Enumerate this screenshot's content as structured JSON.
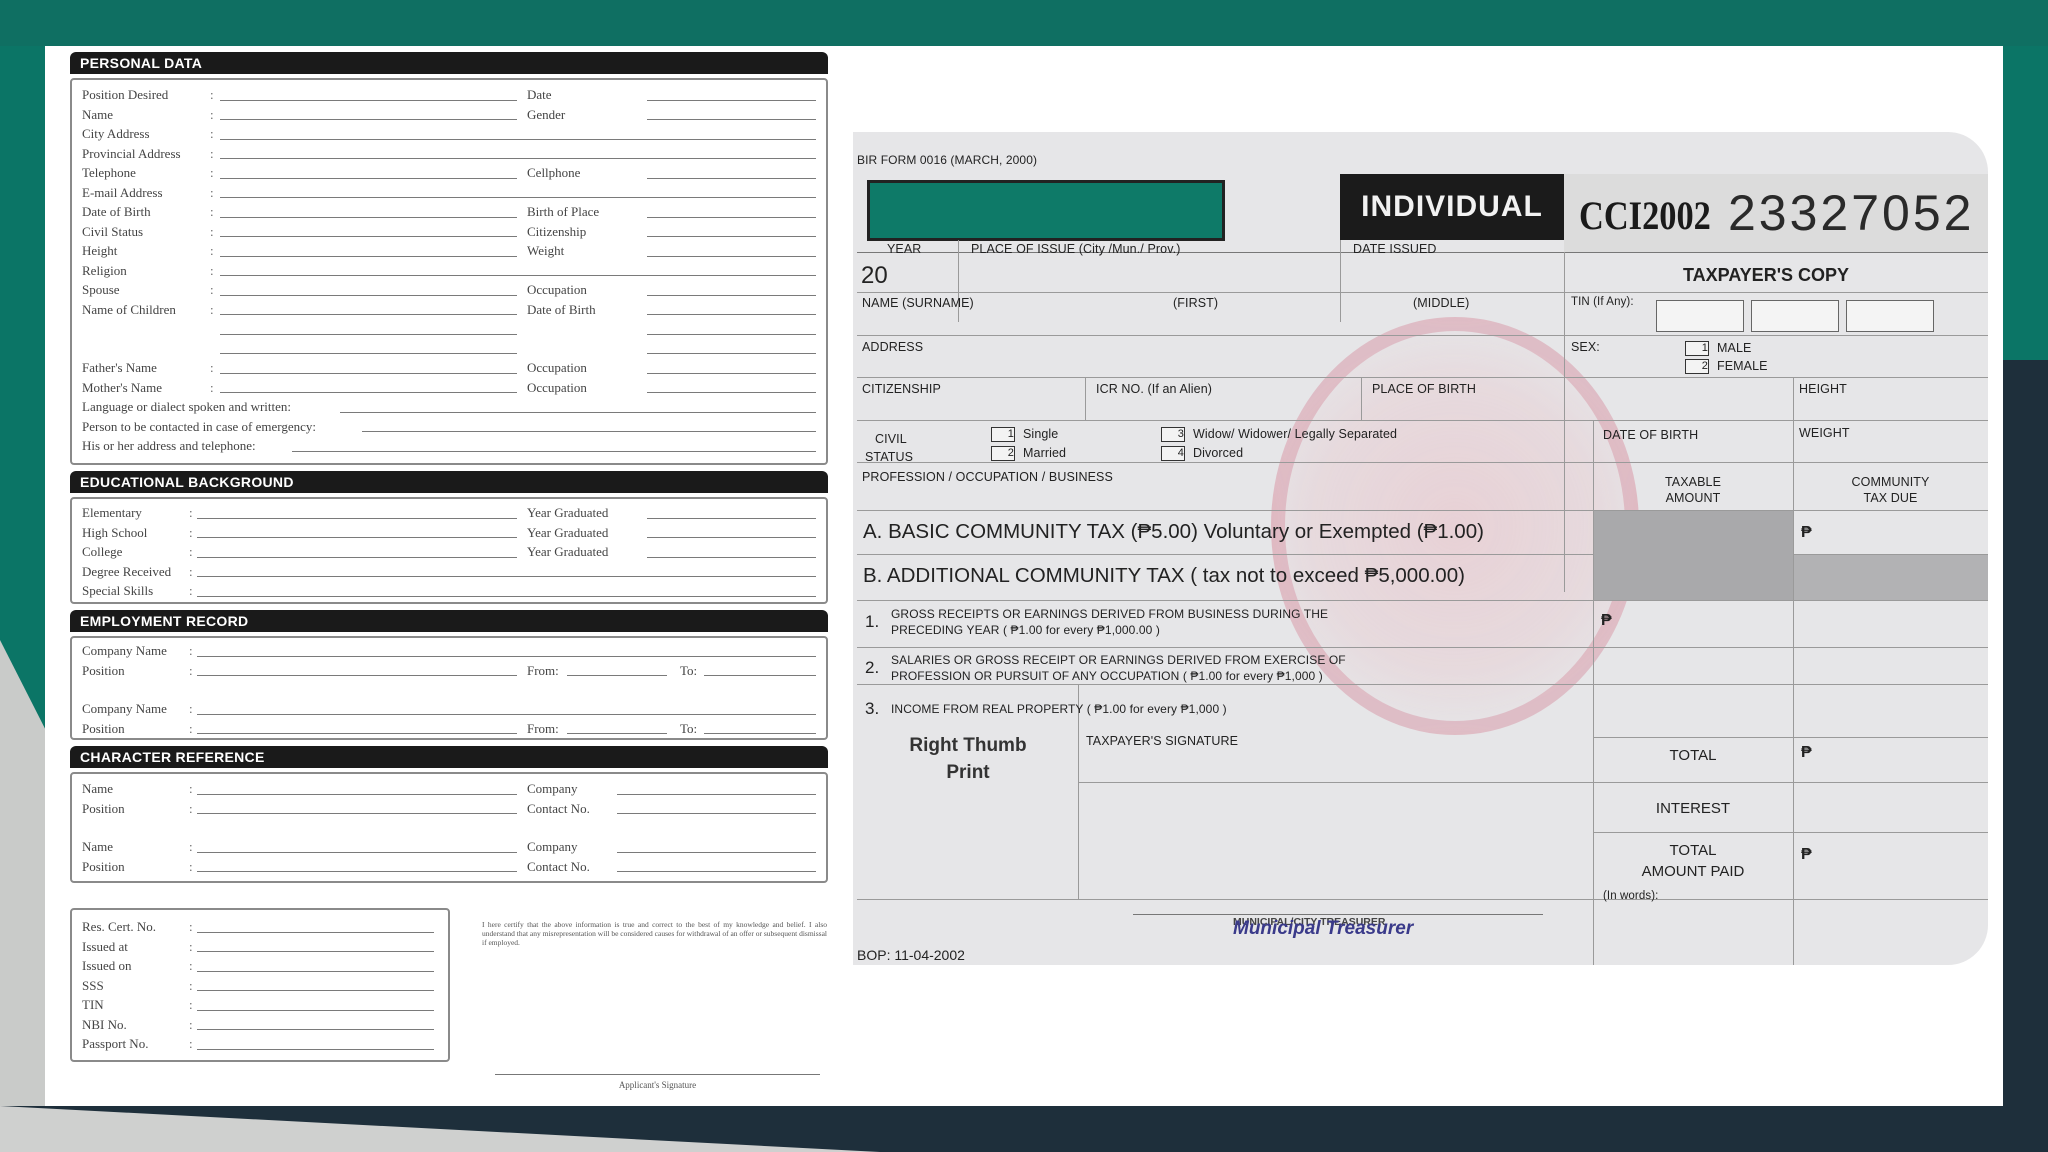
{
  "left_form": {
    "personal_data": {
      "header": "PERSONAL DATA",
      "rows": [
        {
          "left": "Position Desired",
          "right": "Date"
        },
        {
          "left": "Name",
          "right": "Gender"
        },
        {
          "left": "City Address",
          "right": ""
        },
        {
          "left": "Provincial Address",
          "right": ""
        },
        {
          "left": "Telephone",
          "right": "Cellphone"
        },
        {
          "left": "E-mail Address",
          "right": ""
        },
        {
          "left": "Date of Birth",
          "right": "Birth of Place"
        },
        {
          "left": "Civil Status",
          "right": "Citizenship"
        },
        {
          "left": "Height",
          "right": "Weight"
        },
        {
          "left": "Religion",
          "right": ""
        },
        {
          "left": "Spouse",
          "right": "Occupation"
        },
        {
          "left": "Name of Children",
          "right": "Date of Birth"
        },
        {
          "left": "",
          "right": ""
        },
        {
          "left": "",
          "right": ""
        },
        {
          "left": "Father's Name",
          "right": "Occupation"
        },
        {
          "left": "Mother's Name",
          "right": "Occupation"
        }
      ],
      "long_rows": [
        "Language or dialect spoken and written:",
        "Person to be contacted in case of emergency:",
        "His or her address and telephone:"
      ]
    },
    "education": {
      "header": "EDUCATIONAL BACKGROUND",
      "rows": [
        {
          "left": "Elementary",
          "right": "Year Graduated"
        },
        {
          "left": "High School",
          "right": "Year Graduated"
        },
        {
          "left": "College",
          "right": "Year Graduated"
        },
        {
          "left": "Degree Received",
          "right": ""
        },
        {
          "left": "Special Skills",
          "right": ""
        }
      ]
    },
    "employment": {
      "header": "EMPLOYMENT RECORD",
      "company_label": "Company Name",
      "position_label": "Position",
      "from_label": "From:",
      "to_label": "To:"
    },
    "character": {
      "header": "CHARACTER REFERENCE",
      "name_label": "Name",
      "position_label": "Position",
      "company_label": "Company",
      "contact_label": "Contact No."
    },
    "ids": [
      "Res. Cert. No.",
      "Issued at",
      "Issued on",
      "SSS",
      "TIN",
      "NBI No.",
      "Passport No."
    ],
    "certification": "I here certify that the above information is true and correct to the best of my knowledge and belief. I also understand that any misrepresentation will be considered causes for withdrawal of an offer or subsequent dismissal if employed.",
    "signature_label": "Applicant's Signature"
  },
  "cedula": {
    "form_no": "BIR FORM 0016 (MARCH, 2000)",
    "type": "INDIVIDUAL",
    "serial_prefix": "CCI2002",
    "serial": "23327052",
    "copy": "TAXPAYER'S COPY",
    "year_label": "YEAR",
    "year_value": "20",
    "place_label": "PLACE OF ISSUE (City /Mun./ Prov.)",
    "date_issued_label": "DATE ISSUED",
    "name_label": "NAME (SURNAME)",
    "first_label": "(FIRST)",
    "middle_label": "(MIDDLE)",
    "tin_label": "TIN (If Any):",
    "address_label": "ADDRESS",
    "sex_label": "SEX:",
    "male": "MALE",
    "female": "FEMALE",
    "citizenship_label": "CITIZENSHIP",
    "icr_label": "ICR NO. (If an Alien)",
    "pob_label": "PLACE OF BIRTH",
    "height_label": "HEIGHT",
    "civil_label": "CIVIL",
    "status_label": "STATUS",
    "single": "Single",
    "married": "Married",
    "widow": "Widow/ Widower/ Legally Separated",
    "divorced": "Divorced",
    "dob_label": "DATE OF BIRTH",
    "weight_label": "WEIGHT",
    "profession_label": "PROFESSION / OCCUPATION / BUSINESS",
    "taxable_label1": "TAXABLE",
    "taxable_label2": "AMOUNT",
    "community_label1": "COMMUNITY",
    "community_label2": "TAX DUE",
    "basic_tax": "A. BASIC COMMUNITY TAX (₱5.00) Voluntary or Exempted (₱1.00)",
    "additional_tax": "B. ADDITIONAL COMMUNITY TAX ( tax not to exceed ₱5,000.00)",
    "item1_num": "1.",
    "item1_line1": "GROSS RECEIPTS OR EARNINGS DERIVED FROM BUSINESS DURING THE",
    "item1_line2": "PRECEDING YEAR ( ₱1.00 for every ₱1,000.00 )",
    "item2_num": "2.",
    "item2_line1": "SALARIES OR GROSS RECEIPT OR EARNINGS DERIVED FROM  EXERCISE OF",
    "item2_line2": "PROFESSION OR PURSUIT OF ANY OCCUPATION ( ₱1.00 for every ₱1,000 )",
    "item3_num": "3.",
    "item3_text": "INCOME FROM REAL PROPERTY ( ₱1.00 for every ₱1,000 )",
    "thumb1": "Right Thumb",
    "thumb2": "Print",
    "sig_label": "TAXPAYER'S SIGNATURE",
    "total": "TOTAL",
    "interest": "INTEREST",
    "total_paid1": "TOTAL",
    "total_paid2": "AMOUNT PAID",
    "in_words": "(In words):",
    "peso": "₱",
    "treasurer_small": "MUNICIPAL/CITY TREASURER",
    "treasurer_sig": "Municipal Treasurer",
    "footer": "BOP: 11-04-2002",
    "colors": {
      "green_bar": "#0e7a68",
      "dark": "#1b1b1b"
    }
  }
}
